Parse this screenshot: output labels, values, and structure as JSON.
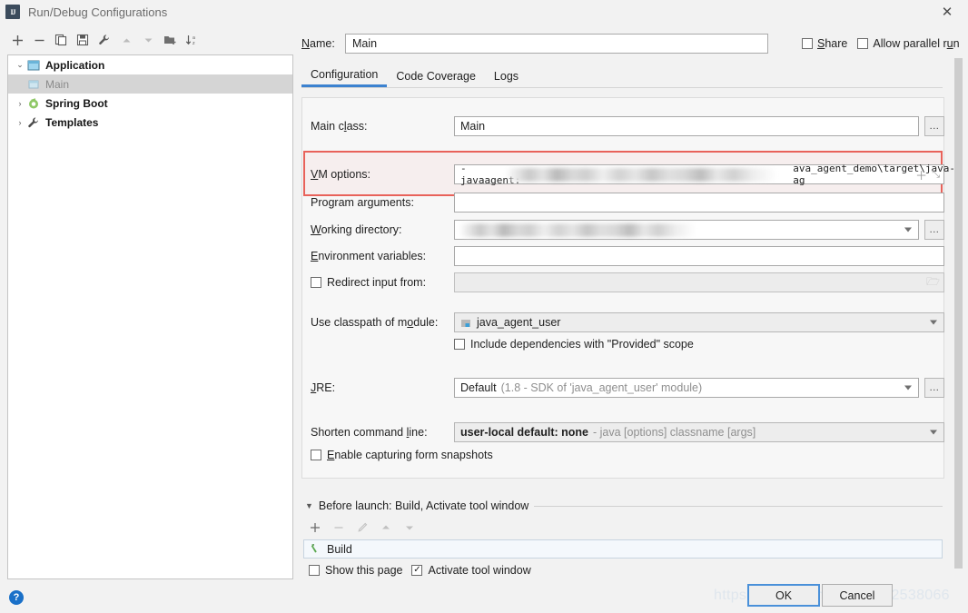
{
  "window": {
    "title": "Run/Debug Configurations",
    "icon": "intellij-idea-icon",
    "close_label": "✕"
  },
  "sidebar": {
    "toolbar": [
      {
        "name": "add-configuration-button",
        "glyph": "＋",
        "dim": false
      },
      {
        "name": "remove-configuration-button",
        "glyph": "−",
        "dim": false
      },
      {
        "name": "copy-configuration-button",
        "glyph": "❐",
        "dim": false
      },
      {
        "name": "save-configuration-button",
        "glyph": "Ὃe",
        "dim": false
      },
      {
        "name": "edit-templates-button",
        "glyph": "ὒ7",
        "dim": false
      },
      {
        "name": "move-up-button",
        "glyph": "▲",
        "dim": true
      },
      {
        "name": "move-down-button",
        "glyph": "▼",
        "dim": true
      },
      {
        "name": "new-folder-button",
        "glyph": "Ὄ1",
        "dim": false
      },
      {
        "name": "sort-alphabetically-button",
        "glyph": "↓",
        "dim": false
      }
    ],
    "tree": [
      {
        "label": "Application",
        "arrow": "⌄",
        "expanded": true,
        "child": false,
        "selected": false,
        "icon": "application-icon"
      },
      {
        "label": "Main",
        "arrow": "",
        "expanded": false,
        "child": true,
        "selected": true,
        "icon": "run-config-icon"
      },
      {
        "label": "Spring Boot",
        "arrow": "›",
        "expanded": false,
        "child": false,
        "selected": false,
        "icon": "spring-boot-icon"
      },
      {
        "label": "Templates",
        "arrow": "›",
        "expanded": false,
        "child": false,
        "selected": false,
        "icon": "templates-wrench-icon"
      }
    ]
  },
  "header": {
    "name_label": "Name:",
    "name_value": "Main",
    "share_label": "Share",
    "share_checked": false,
    "parallel_label": "Allow parallel run",
    "parallel_checked": false
  },
  "tabs": [
    {
      "label": "Configuration",
      "active": true
    },
    {
      "label": "Code Coverage",
      "active": false
    },
    {
      "label": "Logs",
      "active": false
    }
  ],
  "form": {
    "main_class": {
      "label": "Main class:",
      "value": "Main",
      "browse_label": "..."
    },
    "vm_options": {
      "label": "VM options:",
      "value_prefix": "-javaagent:",
      "value_suffix": "ava_agent_demo\\target\\java-ag",
      "redacted": true,
      "highlight_color": "#e8625a",
      "expand_icon": "expand-icon",
      "macro_icon": "insert-macro-icon"
    },
    "program_arguments": {
      "label": "Program arguments:",
      "value": ""
    },
    "working_directory": {
      "label": "Working directory:",
      "value": "",
      "redacted": true,
      "browse_label": "..."
    },
    "environment_variables": {
      "label": "Environment variables:",
      "value": ""
    },
    "redirect_input": {
      "label": "Redirect input from:",
      "checked": false,
      "value": ""
    },
    "classpath_module": {
      "label": "Use classpath of module:",
      "value": "java_agent_user"
    },
    "include_provided": {
      "label": "Include dependencies with \"Provided\" scope",
      "checked": false
    },
    "jre": {
      "label": "JRE:",
      "value": "Default",
      "hint": "(1.8 - SDK of 'java_agent_user' module)",
      "browse_label": "..."
    },
    "shorten_command_line": {
      "label": "Shorten command line:",
      "value": "user-local default: none",
      "hint": "- java [options] classname [args]"
    },
    "form_snapshots": {
      "label": "Enable capturing form snapshots",
      "checked": false
    }
  },
  "before_launch": {
    "title": "Before launch: Build, Activate tool window",
    "collapse_arrow": "▼",
    "toolbar": [
      {
        "name": "add-task-button",
        "glyph": "＋",
        "dim": false
      },
      {
        "name": "remove-task-button",
        "glyph": "−",
        "dim": true
      },
      {
        "name": "edit-task-button",
        "glyph": "✎",
        "dim": true
      },
      {
        "name": "move-task-up-button",
        "glyph": "▲",
        "dim": true
      },
      {
        "name": "move-task-down-button",
        "glyph": "▼",
        "dim": true
      }
    ],
    "tasks": [
      {
        "label": "Build",
        "icon": "build-hammer-icon"
      }
    ],
    "show_this_page": {
      "label": "Show this page",
      "checked": false
    },
    "activate_tool_window": {
      "label": "Activate tool window",
      "checked": true
    }
  },
  "footer": {
    "help_label": "?",
    "ok_label": "OK",
    "cancel_label": "Cancel",
    "watermark": "https://blog.csdn.net/m0_42538066"
  }
}
